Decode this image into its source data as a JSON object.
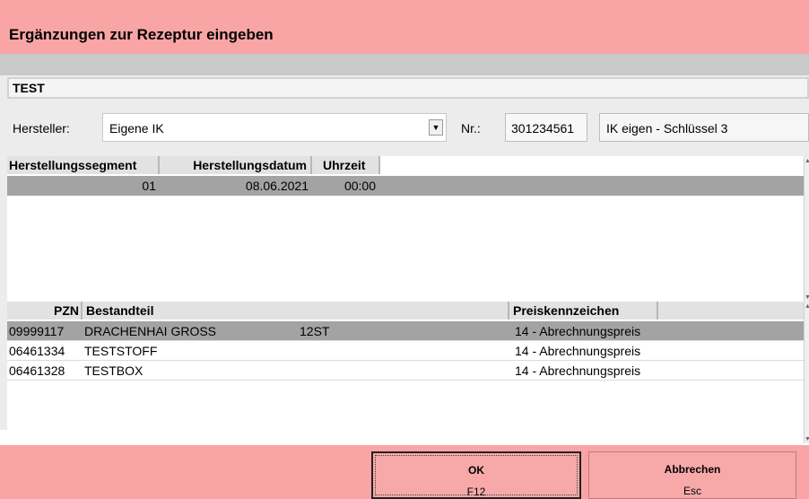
{
  "window": {
    "title": "Ergänzungen zur Rezeptur eingeben"
  },
  "recipe": {
    "name": "TEST"
  },
  "manufacturer": {
    "label": "Hersteller:",
    "value": "Eigene IK",
    "nr_label": "Nr.:",
    "nr_value": "301234561",
    "ik_value": "IK eigen - Schlüssel 3"
  },
  "segments": {
    "columns": [
      "Herstellungssegment",
      "Herstellungsdatum",
      "Uhrzeit"
    ],
    "rows": [
      {
        "segment": "01",
        "date": "08.06.2021",
        "time": "00:00"
      }
    ]
  },
  "components": {
    "columns": [
      "PZN",
      "Bestandteil",
      "Preiskennzeichen"
    ],
    "rows": [
      {
        "pzn": "09999117",
        "name": "DRACHENHAI GROSS",
        "qty": "12ST",
        "price": "14 - Abrechnungspreis"
      },
      {
        "pzn": "06461334",
        "name": "TESTSTOFF",
        "qty": "",
        "price": "14 - Abrechnungspreis"
      },
      {
        "pzn": "06461328",
        "name": "TESTBOX",
        "qty": "",
        "price": "14 - Abrechnungspreis"
      }
    ]
  },
  "buttons": {
    "ok": {
      "label": "OK",
      "shortcut": "F12"
    },
    "cancel": {
      "label": "Abbrechen",
      "shortcut": "Esc"
    }
  },
  "colors": {
    "header_bg": "#f9a5a5",
    "selected_row": "#a3a3a3"
  },
  "icons": {
    "dropdown": "chevron-down-icon",
    "scroll_up": "scroll-up-arrow-icon",
    "scroll_down": "scroll-down-arrow-icon"
  }
}
